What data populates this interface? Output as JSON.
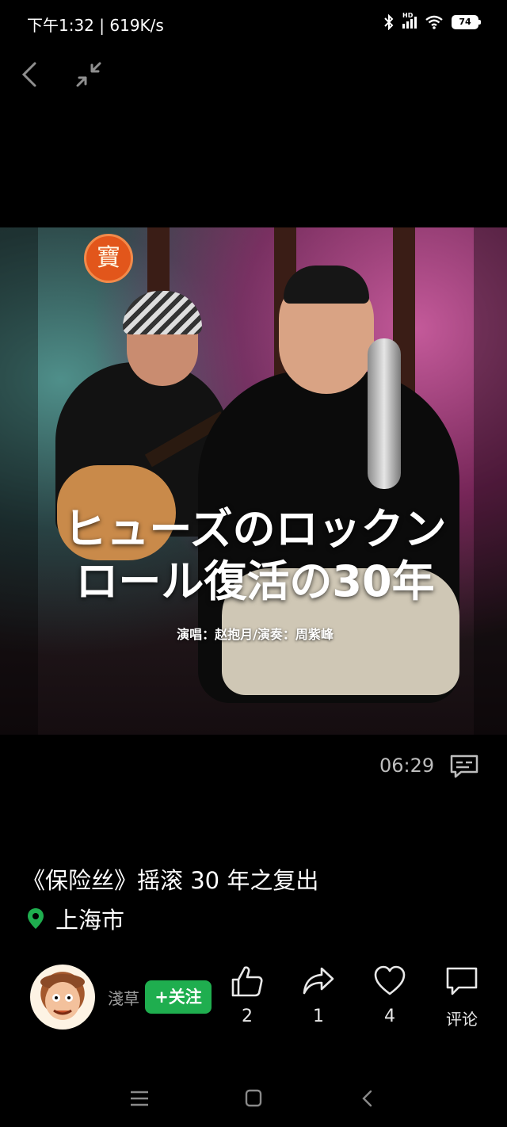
{
  "status_bar": {
    "time_speed": "下午1:32 | 619K/s",
    "battery": "74",
    "network": "HD"
  },
  "video": {
    "overlay_title_line1": "ヒューズのロックン",
    "overlay_title_line2": "ロール復活の30年",
    "credit": "演唱：赵抱月/演奏：周紫峰",
    "logo_char": "寶",
    "duration": "06:29"
  },
  "post": {
    "title": "《保险丝》摇滚 30 年之复出",
    "location": "上海市"
  },
  "author": {
    "name": "淺草",
    "follow_label": "+关注"
  },
  "actions": {
    "like_count": "2",
    "share_count": "1",
    "favorite_count": "4",
    "comment_label": "评论"
  },
  "colors": {
    "accent_green": "#1fae4f",
    "background": "#000000"
  }
}
